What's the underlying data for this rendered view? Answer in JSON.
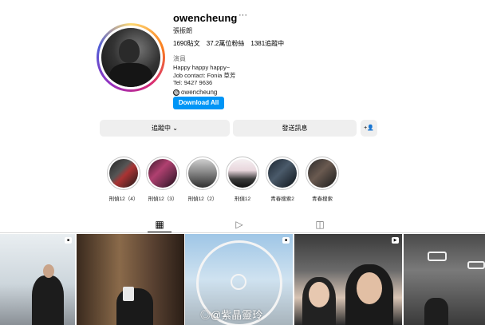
{
  "profile": {
    "username": "owencheung",
    "more_label": "···",
    "full_name": "張振朗",
    "stats": {
      "posts": "1690貼文",
      "followers": "37.2萬位粉絲",
      "following": "1381追蹤中"
    },
    "category": "演員",
    "bio": "Happy happy happy~\nJob contact: Fonia 草芳\nTel: 9427 9636",
    "threads_handle": "owencheung",
    "threads_icon": "@"
  },
  "actions": {
    "download_all": "Download All",
    "following": "追蹤中 ⌄",
    "message": "發送訊息",
    "add_user_icon": "+👤"
  },
  "highlights": [
    {
      "label": "刑偵12（4）"
    },
    {
      "label": "刑偵12（3）"
    },
    {
      "label": "刑偵12（2）"
    },
    {
      "label": "刑偵12"
    },
    {
      "label": "青春搜索2"
    },
    {
      "label": "青春搜索"
    }
  ],
  "tabs": {
    "posts_icon": "▦",
    "reels_icon": "▷",
    "tagged_icon": "◫"
  },
  "watermark": "◎@紫晶靈玲",
  "colors": {
    "accent": "#0095f6",
    "button_gray": "#efefef",
    "border": "#dbdbdb"
  }
}
